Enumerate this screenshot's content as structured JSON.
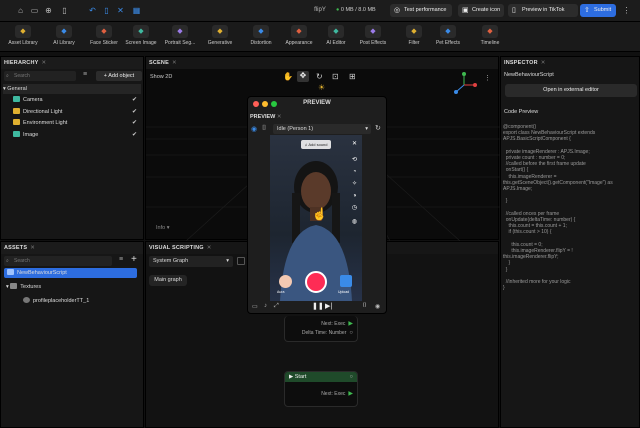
{
  "titlebar": {
    "app_title": "flipY",
    "memory": "0 MB / 8.0 MB",
    "test_performance": "Test performance",
    "create_icon": "Create icon",
    "preview_tiktok": "Preview in TikTok",
    "submit": "Submit"
  },
  "toolbar": {
    "items": [
      {
        "label": "Asset Library",
        "icon": "library-icon"
      },
      {
        "label": "AI Library",
        "icon": "ai-library-icon"
      },
      {
        "label": "Face Sticker",
        "icon": "face-sticker-icon"
      },
      {
        "label": "Screen Image",
        "icon": "screen-image-icon"
      },
      {
        "label": "Portrait Seg...",
        "icon": "portrait-segmentation-icon"
      },
      {
        "label": "Generative",
        "icon": "generative-icon"
      },
      {
        "label": "Distortion",
        "icon": "distortion-icon"
      },
      {
        "label": "Appearance",
        "icon": "appearance-icon"
      },
      {
        "label": "AI Editor",
        "icon": "ai-editor-icon"
      },
      {
        "label": "Post Effects",
        "icon": "post-effects-icon"
      },
      {
        "label": "Filter",
        "icon": "filter-icon"
      },
      {
        "label": "Pet Effects",
        "icon": "pet-effects-icon"
      },
      {
        "label": "Timeline",
        "icon": "timeline-icon"
      }
    ]
  },
  "hierarchy": {
    "title": "HIERARCHY",
    "search_placeholder": "Search",
    "add_object": "Add object",
    "group": "General",
    "items": [
      {
        "label": "Camera",
        "color": "#3fb9a0"
      },
      {
        "label": "Directional Light",
        "color": "#e0b030"
      },
      {
        "label": "Environment Light",
        "color": "#e0b030"
      },
      {
        "label": "Image",
        "color": "#3fb9a0"
      }
    ]
  },
  "assets": {
    "title": "ASSETS",
    "search_placeholder": "Search",
    "items": [
      {
        "label": "NewBehaviourScript",
        "selected": true
      },
      {
        "label": "Textures",
        "selected": false
      },
      {
        "label": "profileplaceholderTT_1",
        "selected": false
      }
    ]
  },
  "scene": {
    "title": "SCENE",
    "show2d": "Show 2D",
    "info": "Info"
  },
  "visual_scripting": {
    "title": "VISUAL SCRIPTING",
    "graph_select": "System Graph",
    "main_graph": "Main graph",
    "node1_next": "Next: Exec",
    "node1_delta": "Delta Time: Number",
    "start_title": "Start",
    "start_next": "Next: Exec"
  },
  "preview": {
    "window_title": "PREVIEW",
    "tab": "PREVIEW",
    "person_select": "Idle (Person 1)",
    "add_sound": "Add sound",
    "left_label": "Aura",
    "right_label": "Upload"
  },
  "inspector": {
    "title": "INSPECTOR",
    "script_name": "NewBehaviourScript",
    "open_external": "Open in external editor",
    "code_preview_label": "Code Preview",
    "code": "@component()\nexport class NewBehaviourScript extends\nAPJS.BasicScriptComponent {\n\n  private imageRenderer : APJS.Image;\n  private count : number = 0;\n  //called before the first frame update\n  onStart() {\n    this.imageRenderer =\nthis.getSceneObject().getComponent(\"Image\") as\nAPJS.Image;\n\n  }\n\n  //called onces per frame\n  onUpdate(deltaTime: number) {\n    this.count = this.count + 1;\n    if (this.count > 10) {\n\n      this.count = 0;\n      this.imageRenderer.flipY = !\nthis.imageRenderer.flipY;\n    }\n  }\n\n  //inherited more for your logic\n}"
  }
}
